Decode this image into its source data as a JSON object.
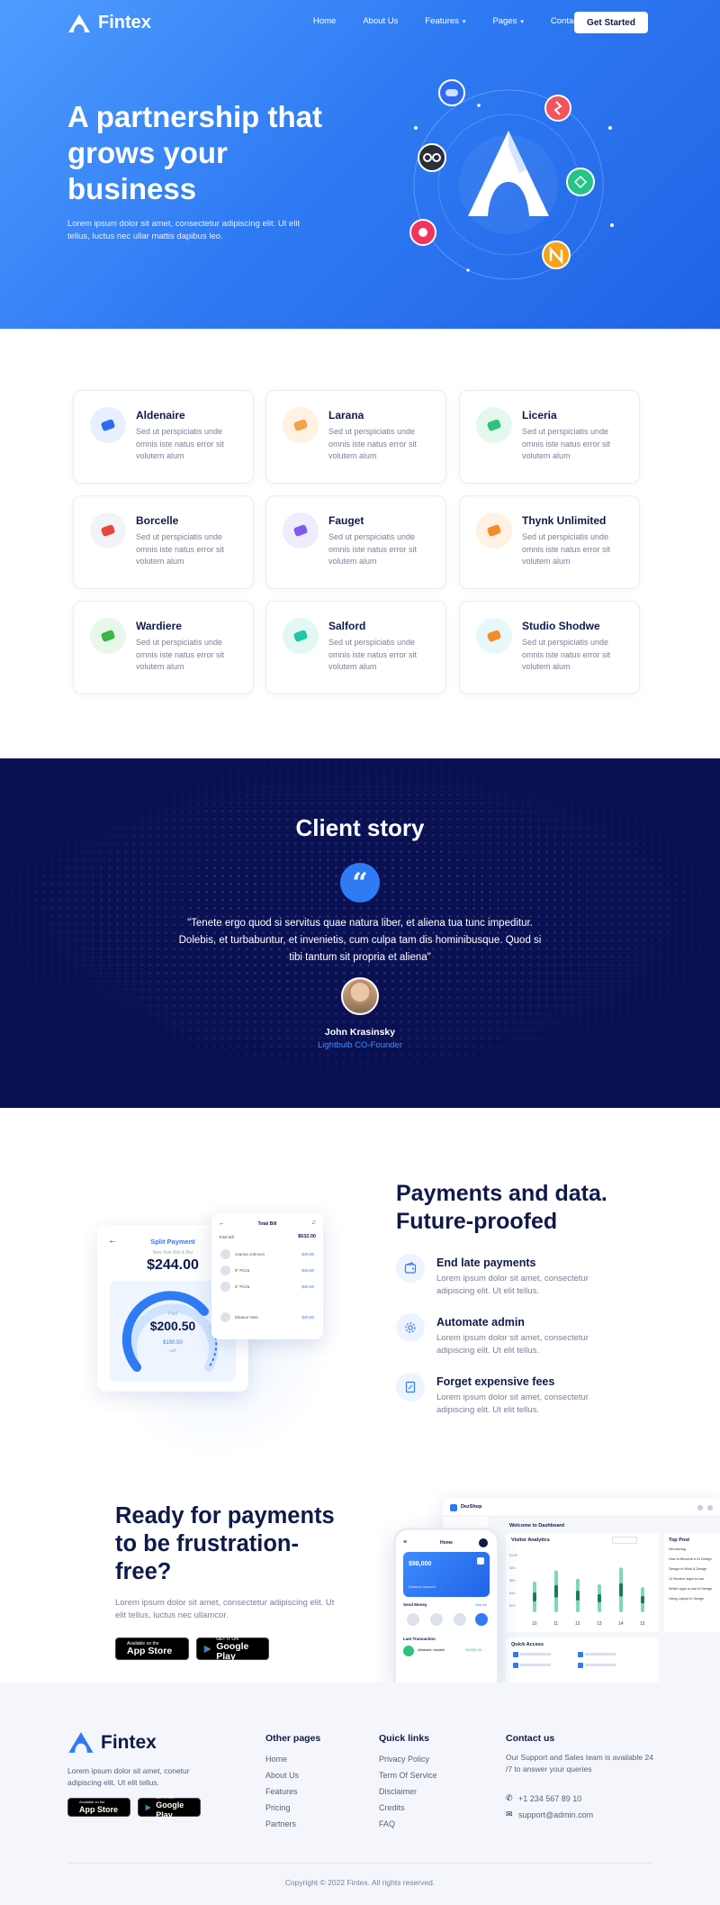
{
  "nav": {
    "brand": "Fintex",
    "links": [
      {
        "label": "Home"
      },
      {
        "label": "About Us"
      },
      {
        "label": "Features",
        "dropdown": true
      },
      {
        "label": "Pages",
        "dropdown": true
      },
      {
        "label": "Contact Us"
      }
    ],
    "cta": "Get Started"
  },
  "hero": {
    "title": "A partnership that grows your business",
    "text": "Lorem ipsum dolor sit amet, consectetur adipiscing elit. Ut elit tellus, luctus nec ullar mattis dapibus leo."
  },
  "partners": [
    {
      "name": "Aldenaire",
      "desc": "Sed ut perspiciatis unde omnis iste natus error sit volutem alum",
      "color": "#2f6bf2",
      "bg": "#e8f0ff"
    },
    {
      "name": "Larana",
      "desc": "Sed ut perspiciatis unde omnis iste natus error sit volutem alum",
      "color": "#f4a14c",
      "bg": "#fff1e3"
    },
    {
      "name": "Liceria",
      "desc": "Sed ut perspiciatis unde omnis iste natus error sit volutem alum",
      "color": "#2ec27e",
      "bg": "#e5f8ee"
    },
    {
      "name": "Borcelle",
      "desc": "Sed ut perspiciatis unde omnis iste natus error sit volutem alum",
      "color": "#e8453c",
      "bg": "#f1f3f7"
    },
    {
      "name": "Fauget",
      "desc": "Sed ut perspiciatis unde omnis iste natus error sit volutem alum",
      "color": "#7c5ce8",
      "bg": "#f0ecff"
    },
    {
      "name": "Thynk Unlimited",
      "desc": "Sed ut perspiciatis unde omnis iste natus error sit volutem alum",
      "color": "#f28c28",
      "bg": "#fff1e3"
    },
    {
      "name": "Wardiere",
      "desc": "Sed ut perspiciatis unde omnis iste natus error sit volutem alum",
      "color": "#3cb54a",
      "bg": "#e8f7e9"
    },
    {
      "name": "Salford",
      "desc": "Sed ut perspiciatis unde omnis iste natus error sit volutem alum",
      "color": "#1fc7a4",
      "bg": "#e3f8f3"
    },
    {
      "name": "Studio Shodwe",
      "desc": "Sed ut perspiciatis unde omnis iste natus error sit volutem alum",
      "color": "#f28c28",
      "bg": "#e6f8fb"
    }
  ],
  "story": {
    "title": "Client story",
    "quote": "\"Tenete ergo quod si servitus quae natura liber, et aliena tua tunc impeditur. Dolebis, et turbabuntur, et invenietis, cum culpa tam dis hominibusque. Quod si tibi tantum sit propria et aliena\"",
    "author": "John Krasinsky",
    "role": "Lightbulb CO-Founder"
  },
  "payments": {
    "title": "Payments and data. Future-proofed",
    "features": [
      {
        "title": "End late payments",
        "desc": "Lorem ipsum dolor sit amet, consectetur adipiscing elit. Ut elit tellus.",
        "icon": "wallet-icon"
      },
      {
        "title": "Automate admin",
        "desc": "Lorem ipsum dolor sit amet, consectetur adipiscing elit. Ut elit tellus.",
        "icon": "gear-icon"
      },
      {
        "title": "Forget expensive fees",
        "desc": "Lorem ipsum dolor sit amet, consectetur adipiscing elit. Ut elit tellus.",
        "icon": "receipt-icon"
      }
    ],
    "mock": {
      "split_title": "Split Payment",
      "split_sub": "New York Brill & Bar",
      "split_amount": "$244.00",
      "paid_label": "Paid",
      "paid_amount": "$200.50",
      "left_amount": "$150.50",
      "left_label": "Left",
      "bill_title": "Total Bill",
      "bill_label": "Total Bill",
      "bill_total": "$632.00",
      "rows": [
        {
          "name": "Joanna Johnson",
          "amount": "$40.00"
        },
        {
          "name": "6\" Pizza",
          "amount": "$40.00"
        },
        {
          "name": "6\" Pizza",
          "amount": "$40.00"
        },
        {
          "name": "Eleanor Vant",
          "amount": "$40.00"
        }
      ]
    }
  },
  "cta": {
    "title": "Ready for payments to be frustration-free?",
    "text": "Lorem ipsum dolor sit amet, consectetur adipiscing elit. Ut elit tellus, luctus nec ullamcor.",
    "appstore_small": "Available on the",
    "appstore_big": "App Store",
    "play_small": "GET IT ON",
    "play_big": "Google Play",
    "dashboard": {
      "brand": "DezShop",
      "welcome": "Welcome to Dashboard",
      "analytics": "Visitor Analytics",
      "top_post": "Top Post",
      "quick_access": "Quick Access",
      "axis": [
        "10",
        "11",
        "12",
        "13",
        "14",
        "15"
      ],
      "y_axis": [
        "$100",
        "$80",
        "$60",
        "$40",
        "$20"
      ],
      "bars": [
        0.55,
        0.75,
        0.6,
        0.5,
        0.8,
        0.45
      ],
      "posts": [
        "Introducing",
        "How to Become a UI Design",
        "Design of Work & Design",
        "12 Modern ways to use",
        "Which apps to use in Design",
        "Using Layout In Design"
      ]
    },
    "phone": {
      "header": "Home",
      "card_balance": "$98,000",
      "card_name": "Balance Account",
      "send_money": "Send Money",
      "see_all": "See All",
      "last_tx": "Last Transaction",
      "tx_name": "Alfabakin Installe",
      "tx_amount": "+$1990.00"
    }
  },
  "footer": {
    "brand": "Fintex",
    "text": "Lorem ipsum dolor sit amet, conetur adipiscing elit. Ut elit tellus.",
    "appstore_small": "Available on the",
    "appstore_big": "App Store",
    "play_small": "GET IT ON",
    "play_big": "Google Play",
    "other_title": "Other pages",
    "other": [
      "Home",
      "About Us",
      "Features",
      "Pricing",
      "Partners"
    ],
    "quick_title": "Quick links",
    "quick": [
      "Privacy Policy",
      "Term Of Service",
      "Disclaimer",
      "Credits",
      "FAQ"
    ],
    "contact_title": "Contact us",
    "contact_text": "Our Support and Sales team is available 24 /7 to answer your queries",
    "phone": "+1 234 567 89 10",
    "email": "support@admin.com",
    "copyright": "Copyright © 2022 Fintex. All rights reserved."
  },
  "colors": {
    "primary": "#2f7bf3",
    "navy": "#0a1152",
    "text": "#0f1a4a"
  }
}
